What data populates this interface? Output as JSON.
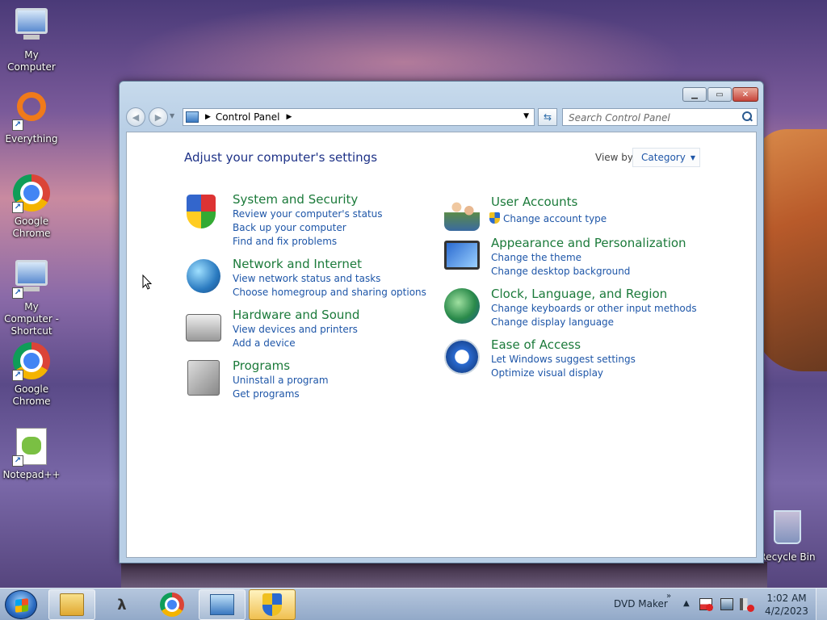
{
  "desktop": {
    "icons": [
      {
        "label": "My Computer"
      },
      {
        "label": "Everything"
      },
      {
        "label": "Google Chrome"
      },
      {
        "label": "My Computer - Shortcut"
      },
      {
        "label": "Google Chrome"
      },
      {
        "label": "Notepad++"
      },
      {
        "label": "Recycle Bin"
      }
    ]
  },
  "window": {
    "breadcrumb": {
      "root": "Control Panel"
    },
    "search": {
      "placeholder": "Search Control Panel"
    },
    "page_title": "Adjust your computer's settings",
    "view_by": {
      "label": "View by:",
      "value": "Category"
    },
    "categories": [
      {
        "title": "System and Security",
        "icon": "shield-icon",
        "links": [
          "Review your computer's status",
          "Back up your computer",
          "Find and fix problems"
        ]
      },
      {
        "title": "Network and Internet",
        "icon": "globe-network-icon",
        "links": [
          "View network status and tasks",
          "Choose homegroup and sharing options"
        ]
      },
      {
        "title": "Hardware and Sound",
        "icon": "printer-speaker-icon",
        "links": [
          "View devices and printers",
          "Add a device"
        ]
      },
      {
        "title": "Programs",
        "icon": "programs-icon",
        "links": [
          "Uninstall a program",
          "Get programs"
        ]
      },
      {
        "title": "User Accounts",
        "icon": "users-icon",
        "links": [
          "Change account type"
        ]
      },
      {
        "title": "Appearance and Personalization",
        "icon": "appearance-icon",
        "links": [
          "Change the theme",
          "Change desktop background"
        ]
      },
      {
        "title": "Clock, Language, and Region",
        "icon": "clock-globe-icon",
        "links": [
          "Change keyboards or other input methods",
          "Change display language"
        ]
      },
      {
        "title": "Ease of Access",
        "icon": "ease-of-access-icon",
        "links": [
          "Let Windows suggest settings",
          "Optimize visual display"
        ]
      }
    ]
  },
  "taskbar": {
    "tray_label": "DVD Maker",
    "time": "1:02 AM",
    "date": "4/2/2023"
  }
}
